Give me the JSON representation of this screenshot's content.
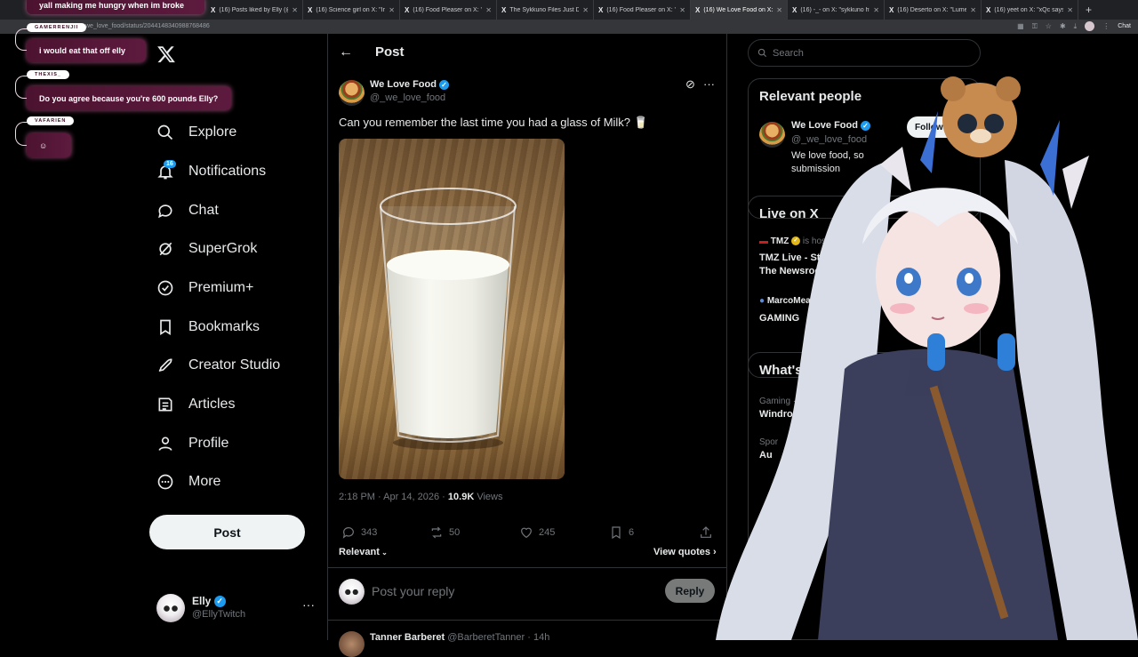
{
  "browser": {
    "tabs": [
      {
        "title": "(16) Posts liked by Elly (@Elly",
        "active": false
      },
      {
        "title": "(16) Science girl on X: \"Irides",
        "active": false
      },
      {
        "title": "(16) Food Pleaser on X: \"Des",
        "active": false
      },
      {
        "title": "The Sykkuno Files Just Drop",
        "active": false
      },
      {
        "title": "(16) Food Pleaser on X: \"Her",
        "active": false
      },
      {
        "title": "(16) We Love Food on X: \"Ca",
        "active": true
      },
      {
        "title": "(16) -_- on X: \"sykkuno http",
        "active": false
      },
      {
        "title": "(16) Deserto on X: \"Lumen C",
        "active": false
      },
      {
        "title": "(16) yeet on X: \"xQc says Syk",
        "active": false
      }
    ],
    "url": "we_love_food/status/2044148340988768486",
    "chat_label": "Chat"
  },
  "chat_overlay": [
    {
      "user": "",
      "message": "yall making me hungry when im broke"
    },
    {
      "user": "GAMERRENJII",
      "message": "i would eat that off elly"
    },
    {
      "user": "THEXIS_",
      "message": "Do you agree because you're 600 pounds Elly?"
    },
    {
      "user": "VAFARIEN",
      "message": "☺"
    }
  ],
  "nav": {
    "items": [
      {
        "label": "Explore",
        "icon": "search-icon"
      },
      {
        "label": "Notifications",
        "icon": "bell-icon",
        "badge": "16"
      },
      {
        "label": "Chat",
        "icon": "chat-bubble-icon"
      },
      {
        "label": "SuperGrok",
        "icon": "grok-icon"
      },
      {
        "label": "Premium+",
        "icon": "verified-badge-icon"
      },
      {
        "label": "Bookmarks",
        "icon": "bookmark-icon"
      },
      {
        "label": "Creator Studio",
        "icon": "rocket-icon"
      },
      {
        "label": "Articles",
        "icon": "article-icon"
      },
      {
        "label": "Profile",
        "icon": "person-icon"
      },
      {
        "label": "More",
        "icon": "more-circle-icon"
      }
    ],
    "post_button": "Post",
    "account": {
      "name": "Elly",
      "handle": "@EllyTwitch"
    }
  },
  "post": {
    "header": "Post",
    "author": {
      "name": "We Love Food",
      "handle": "@_we_love_food"
    },
    "text": "Can you remember the last time you had a glass of Milk? 🥛",
    "time": "2:18 PM · Apr 14, 2026 · ",
    "views_count": "10.9K",
    "views_label": " Views",
    "stats": {
      "replies": "343",
      "reposts": "50",
      "likes": "245",
      "bookmarks": "6"
    },
    "sort_label": "Relevant",
    "view_quotes": "View quotes",
    "reply_placeholder": "Post your reply",
    "reply_button": "Reply",
    "next_reply_name": "Tanner Barberet",
    "next_reply_handle": "@BarberetTanner · 14h"
  },
  "sidebar": {
    "search_placeholder": "Search",
    "relevant_people": {
      "title": "Relevant people",
      "name": "We Love Food",
      "handle": "@_we_love_food",
      "bio_line1": "We love food, so",
      "bio_line2": "submission",
      "follow": "Follow"
    },
    "live": {
      "title": "Live on X",
      "item1_host": "TMZ",
      "item1_status": " is hosting",
      "item1_title_line1": "TMZ Live - Strea",
      "item1_title_line2": "The Newsroom!",
      "item2_host": "MarcoMeatba",
      "item2_title": "GAMING"
    },
    "happening": {
      "title": "What's h",
      "item1_cat": "Gaming · T",
      "item1_title": "Windro",
      "item2_cat": "Spor",
      "item2_title": "Au"
    }
  }
}
